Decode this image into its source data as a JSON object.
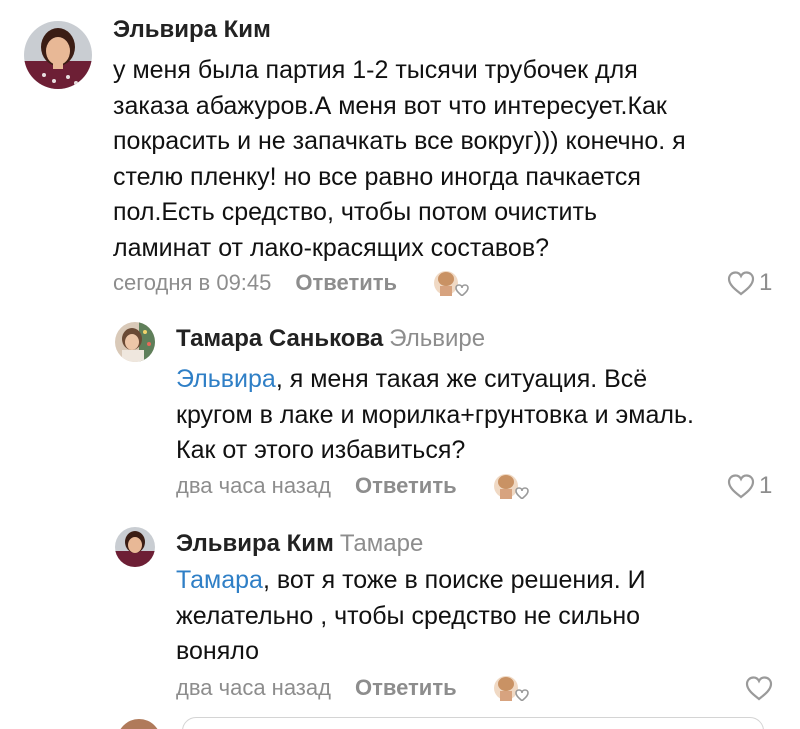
{
  "comments": [
    {
      "author": "Эльвира Ким",
      "text": "у меня была партия 1-2 тысячи трубочек для\nзаказа абажуров.А меня вот что интересует.Как\nпокрасить и не запачкать все вокруг))) конечно. я\nстелю пленку! но все равно иногда пачкается\nпол.Есть средство, чтобы потом очистить\nламинат от лако-красящих составов?",
      "time": "сегодня в 09:45",
      "reply_label": "Ответить",
      "likes": "1"
    },
    {
      "author": "Тамара Санькова",
      "reply_to": "Эльвире",
      "mention": "Эльвира",
      "text": ", я меня такая же ситуация. Всё\nкругом в лаке и морилка+грунтовка и эмаль.\nКак от этого избавиться?",
      "time": "два часа назад",
      "reply_label": "Ответить",
      "likes": "1"
    },
    {
      "author": "Эльвира Ким",
      "reply_to": "Тамаре",
      "mention": "Тамара",
      "text": ",  вот я тоже в поиске решения. И\nжелательно , чтобы средство  не сильно\nвоняло",
      "time": "два часа назад",
      "reply_label": "Ответить",
      "likes": ""
    }
  ],
  "colors": {
    "link": "#2f7fc6",
    "muted": "#8d8d8d",
    "author": "#222222"
  },
  "icons": {
    "react": "react-face-heart-icon",
    "like": "heart-outline-icon"
  }
}
